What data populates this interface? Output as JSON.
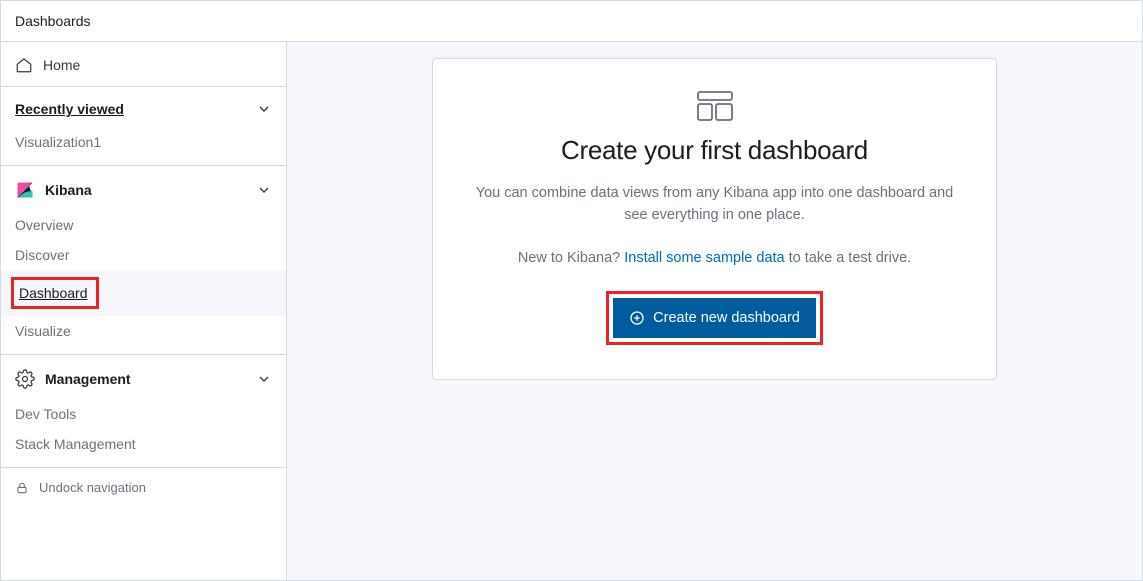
{
  "header": {
    "title": "Dashboards"
  },
  "sidebar": {
    "home": {
      "label": "Home"
    },
    "recently_viewed": {
      "label": "Recently viewed",
      "items": [
        {
          "label": "Visualization1"
        }
      ]
    },
    "kibana": {
      "label": "Kibana",
      "items": [
        {
          "label": "Overview"
        },
        {
          "label": "Discover"
        },
        {
          "label": "Dashboard",
          "active": true
        },
        {
          "label": "Visualize"
        }
      ]
    },
    "management": {
      "label": "Management",
      "items": [
        {
          "label": "Dev Tools"
        },
        {
          "label": "Stack Management"
        }
      ]
    },
    "undock": {
      "label": "Undock navigation"
    }
  },
  "main": {
    "heading": "Create your first dashboard",
    "line1": "You can combine data views from any Kibana app into one dashboard and see everything in one place.",
    "line2_pre": "New to Kibana? ",
    "line2_link": "Install some sample data",
    "line2_post": " to take a test drive.",
    "cta": "Create new dashboard"
  }
}
